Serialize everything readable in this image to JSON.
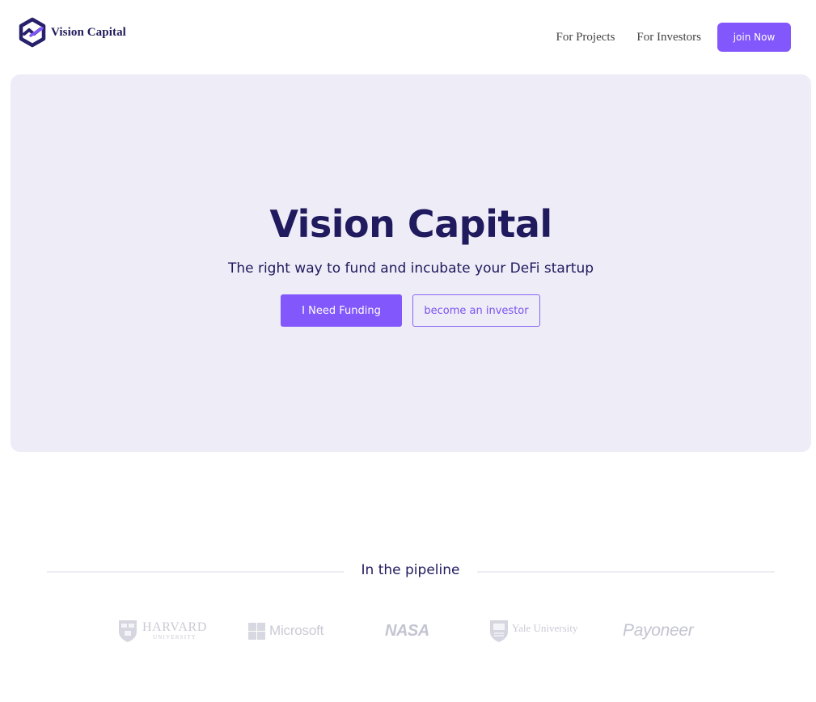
{
  "brand": {
    "name": "Vision Capital",
    "logo_icon": "hexagon-logo-icon",
    "colors": {
      "dark": "#27206a",
      "accent": "#8257fb"
    }
  },
  "nav": {
    "links": [
      "For Projects",
      "For Investors"
    ],
    "cta_label": "join Now"
  },
  "hero": {
    "title": "Vision Capital",
    "subtitle": "The right way to fund and incubate your DeFi startup",
    "primary_button": "I Need Funding",
    "secondary_button": "become an investor",
    "background": "#eeecf7"
  },
  "pipeline": {
    "title": "In the pipeline",
    "partners": [
      {
        "name": "HARVARD",
        "sub": "UNIVERSITY",
        "icon": "harvard-shield-icon"
      },
      {
        "name": "Microsoft",
        "icon": "microsoft-windows-icon"
      },
      {
        "name": "NASA",
        "icon": "nasa-worm-icon"
      },
      {
        "name": "Yale University",
        "icon": "yale-shield-icon"
      },
      {
        "name": "Payoneer",
        "icon": "payoneer-logo-icon"
      }
    ]
  }
}
